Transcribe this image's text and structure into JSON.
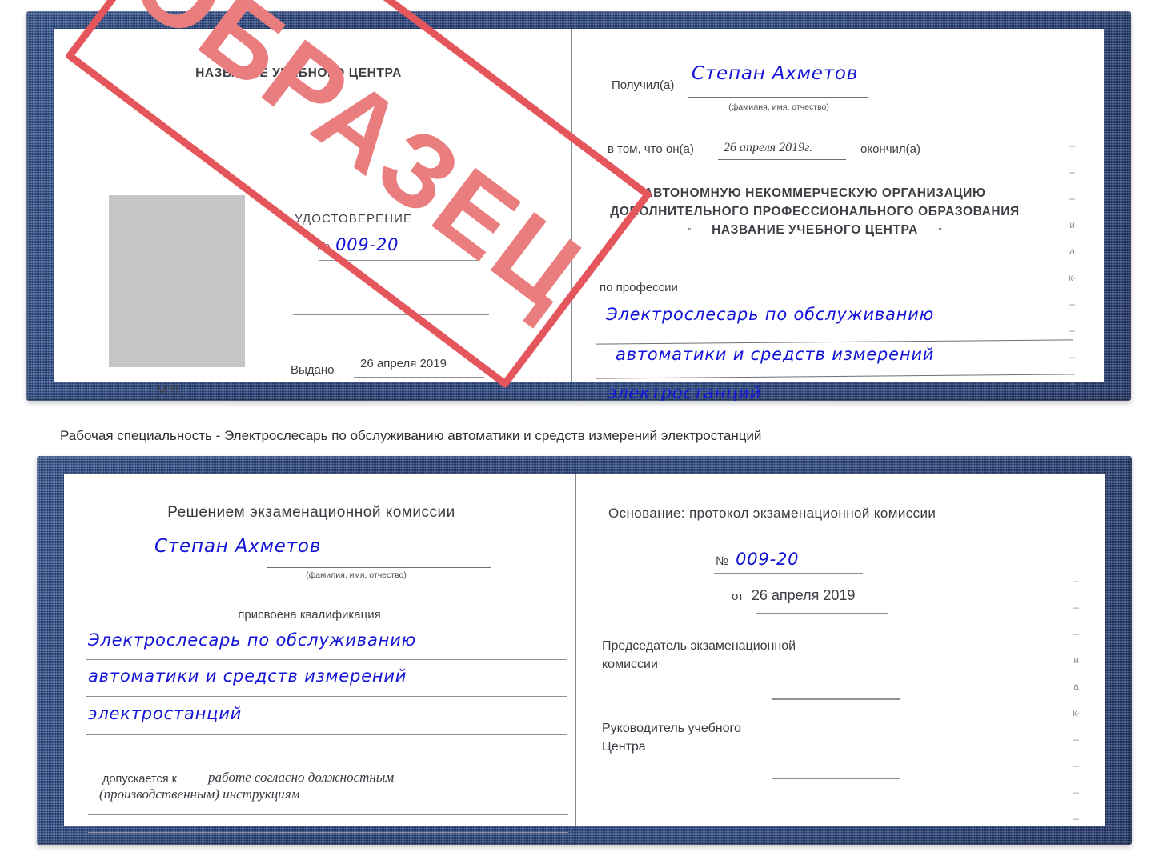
{
  "caption": "Рабочая специальность - Электрослесарь по обслуживанию автоматики и средств измерений электростанций",
  "watermark": {
    "text": "ОБРАЗЕЦ",
    "frame_color": "#e5565c",
    "text_color": "#ea7d7e"
  },
  "colors": {
    "cover_blue": "#2d4a86",
    "ink_blue": "#1414d8",
    "paper": "#ffffff",
    "photo_placeholder": "#c6c6c8"
  },
  "certificate_top": {
    "left_page": {
      "center_name": "НАЗВАНИЕ УЧЕБНОГО ЦЕНТРА",
      "doc_title": "УДОСТОВЕРЕНИЕ",
      "number_prefix": "№",
      "number_value": "009-20",
      "issued_label": "Выдано",
      "issued_value": "26 апреля 2019",
      "seal_label": "М.П.",
      "photo_label": "photo-placeholder"
    },
    "right_page": {
      "received_label": "Получил(а)",
      "received_value": "Степан Ахметов",
      "fio_hint": "(фамилия, имя, отчество)",
      "that_he_label": "в том, что он(а)",
      "graduation_date": "26 апреля 2019г.",
      "finished_label": "окончил(а)",
      "org_line1": "АВТОНОМНУЮ НЕКОММЕРЧЕСКУЮ ОРГАНИЗАЦИЮ",
      "org_line2": "ДОПОЛНИТЕЛЬНОГО ПРОФЕССИОНАЛЬНОГО ОБРАЗОВАНИЯ",
      "org_quote_open": "\"",
      "org_line3": "НАЗВАНИЕ УЧЕБНОГО ЦЕНТРА",
      "org_quote_close": "\"",
      "profession_label": "по профессии",
      "profession_line1": "Электрослесарь по обслуживанию",
      "profession_line2": "автоматики и средств измерений",
      "profession_line3": "электростанций",
      "edge_marks": [
        "–",
        "–",
        "–",
        "и",
        "а",
        "к-",
        "–",
        "–",
        "–",
        "–"
      ]
    }
  },
  "certificate_bottom": {
    "left_page": {
      "decision_title": "Решением экзаменационной комиссии",
      "name_value": "Степан Ахметов",
      "fio_hint": "(фамилия, имя, отчество)",
      "qualification_label": "присвоена квалификация",
      "qualification_line1": "Электрослесарь по обслуживанию",
      "qualification_line2": "автоматики и средств измерений",
      "qualification_line3": "электростанций",
      "admitted_label": "допускается к",
      "admitted_value_line1": "работе согласно должностным",
      "admitted_value_line2": "(производственным) инструкциям"
    },
    "right_page": {
      "basis_label": "Основание: протокол экзаменационной комиссии",
      "number_prefix": "№",
      "number_value": "009-20",
      "date_prefix": "от",
      "date_value": "26 апреля 2019",
      "chairman_line1": "Председатель экзаменационной",
      "chairman_line2": "комиссии",
      "head_line1": "Руководитель учебного",
      "head_line2": "Центра",
      "edge_marks": [
        "–",
        "–",
        "–",
        "и",
        "а",
        "к-",
        "–",
        "–",
        "–",
        "–"
      ]
    }
  }
}
